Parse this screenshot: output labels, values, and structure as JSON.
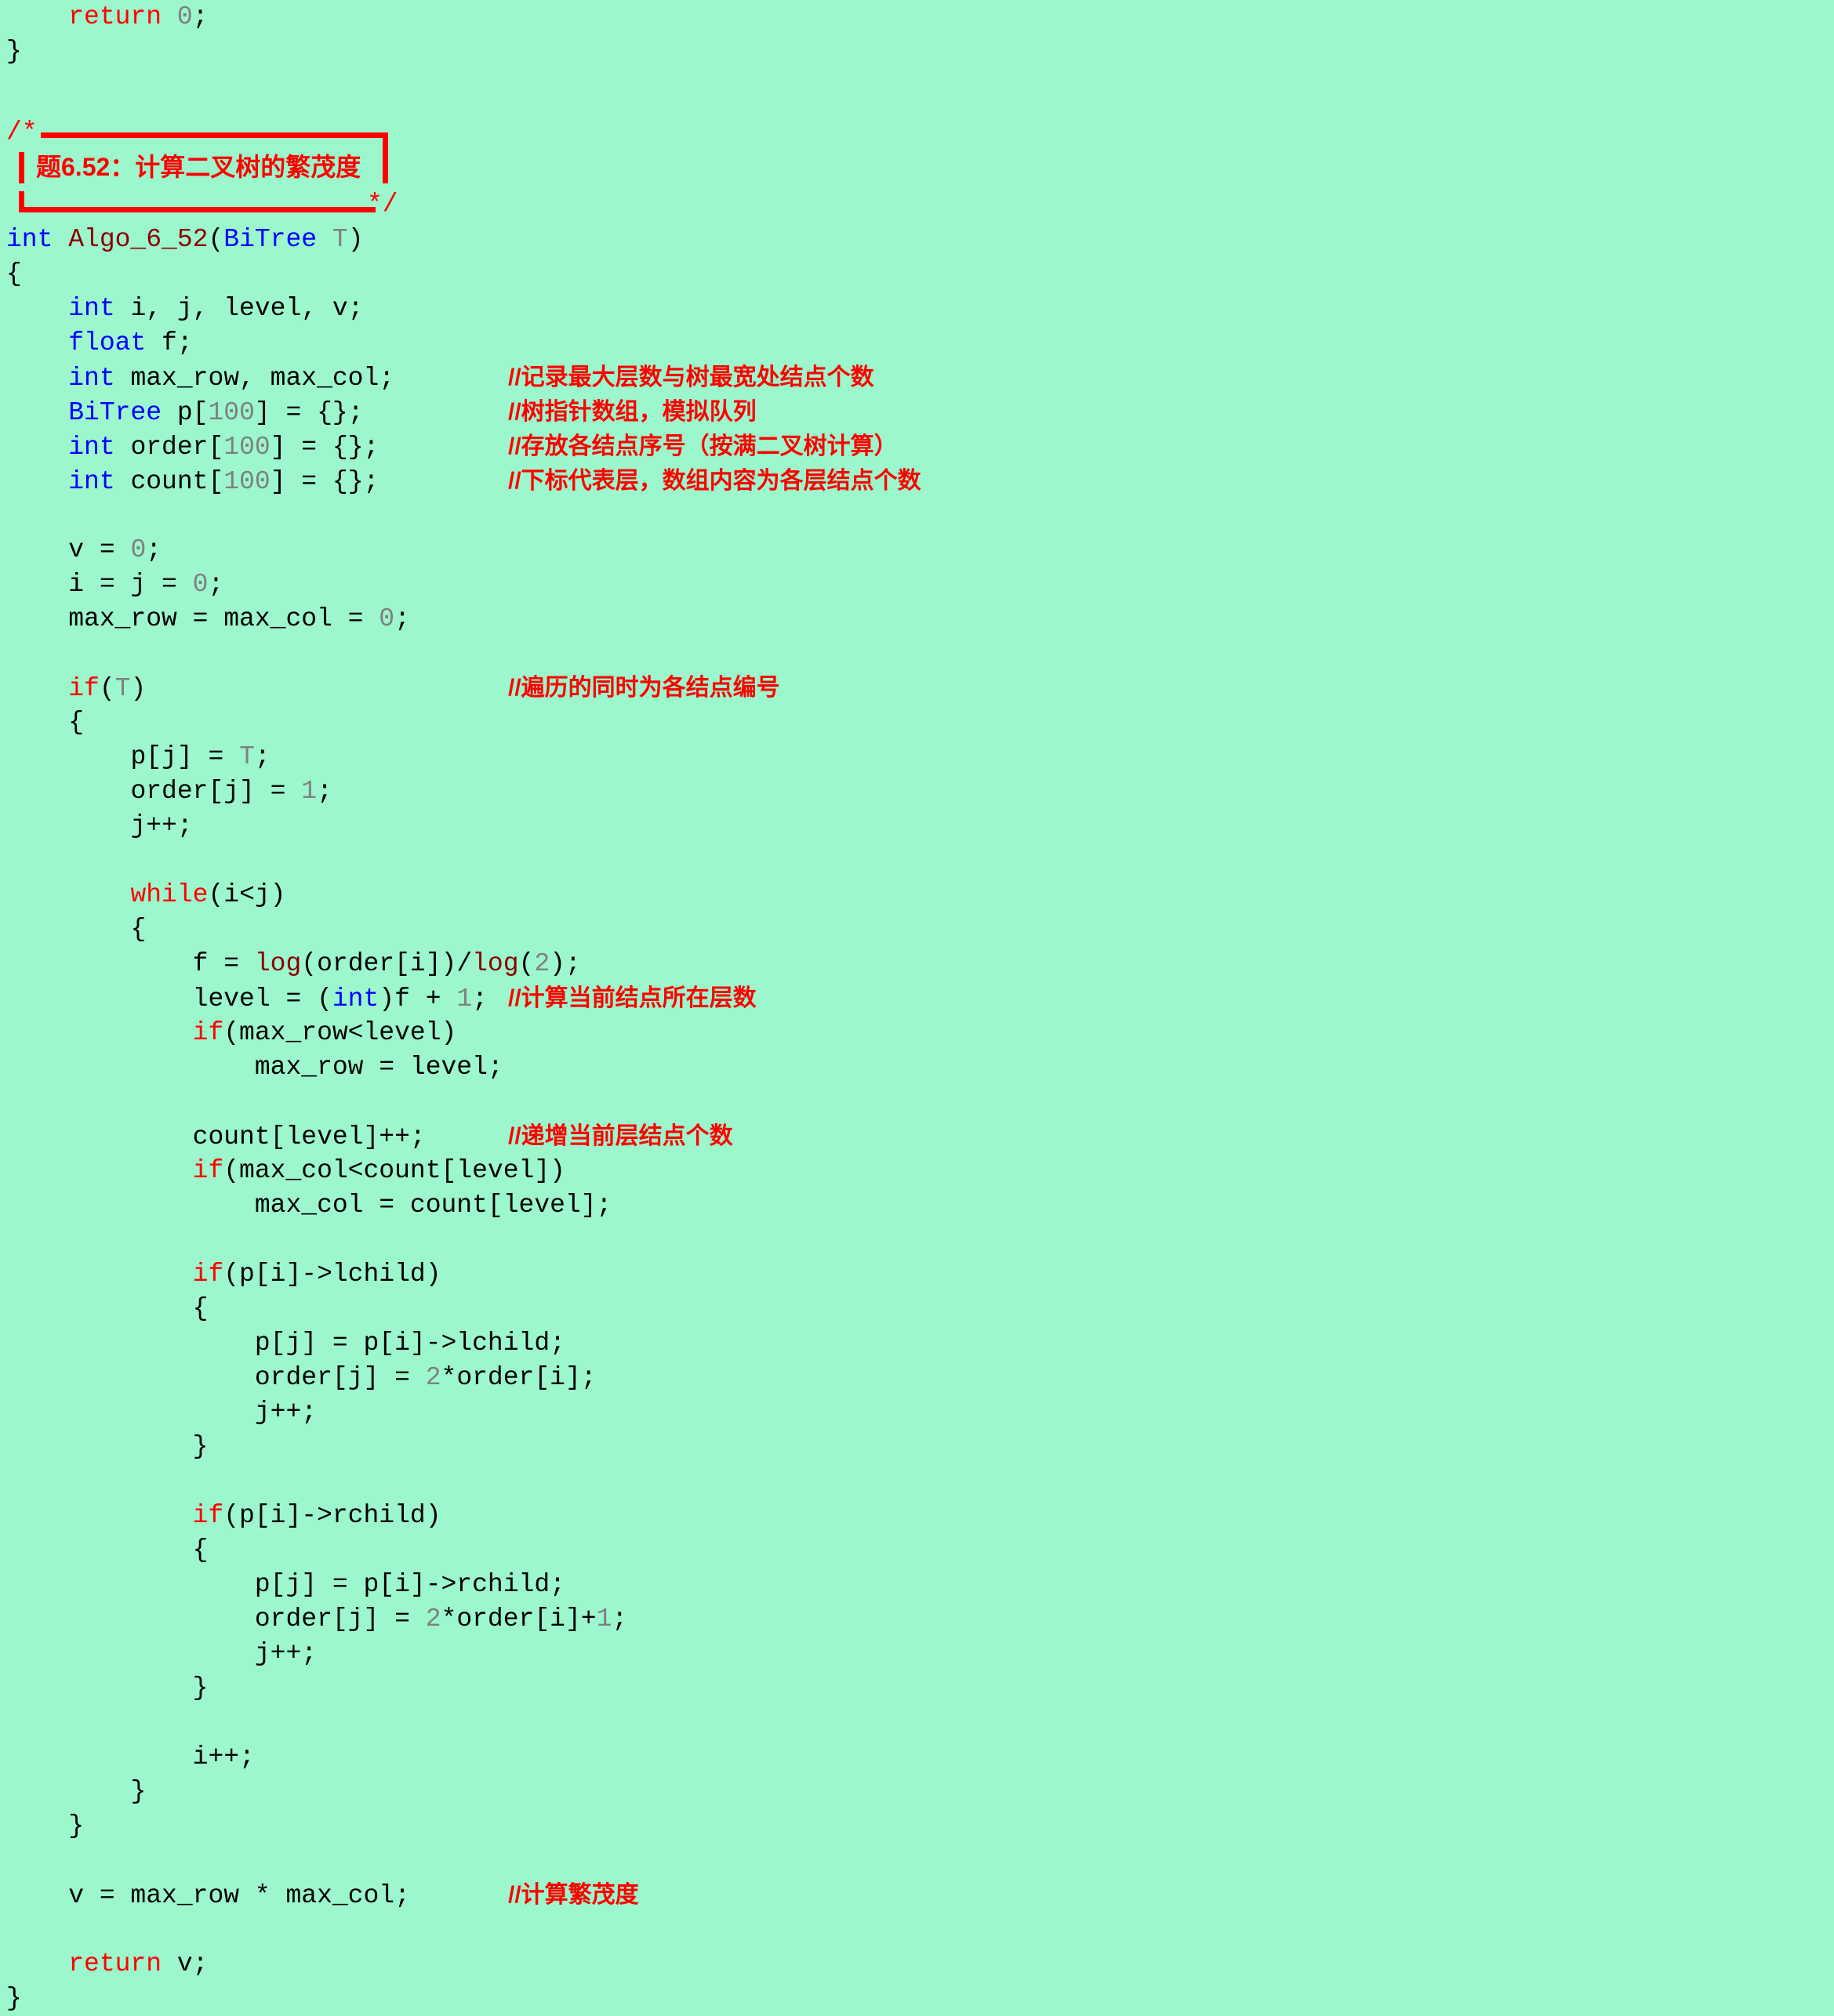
{
  "document": {
    "background_color": "#9cf7cd",
    "language": "C",
    "title_banner": {
      "open_marker": "/*",
      "close_marker": "*/",
      "text": "题6.52：计算二叉树的繁茂度",
      "border_color": "#ff0000",
      "text_color": "#ff0000"
    },
    "colors": {
      "keyword": "#0000ff",
      "control": "#ff0000",
      "function": "#8b0000",
      "number": "#808080",
      "comment": "#ff0000",
      "plain": "#000000"
    }
  },
  "code": {
    "prev_tail": [
      {
        "indent": 1,
        "tokens": [
          {
            "t": "return ",
            "c": "ctrl"
          },
          {
            "t": "0",
            "c": "num"
          },
          {
            "t": ";",
            "c": "plain"
          }
        ]
      },
      {
        "indent": 0,
        "tokens": [
          {
            "t": "}",
            "c": "plain"
          }
        ]
      }
    ],
    "lines": [
      {
        "indent": 0,
        "tokens": [
          {
            "t": "int ",
            "c": "kw"
          },
          {
            "t": "Algo_6_52",
            "c": "fn"
          },
          {
            "t": "(",
            "c": "plain"
          },
          {
            "t": "BiTree",
            "c": "kw"
          },
          {
            "t": " ",
            "c": "plain"
          },
          {
            "t": "T",
            "c": "param"
          },
          {
            "t": ")",
            "c": "plain"
          }
        ]
      },
      {
        "indent": 0,
        "tokens": [
          {
            "t": "{",
            "c": "plain"
          }
        ]
      },
      {
        "indent": 1,
        "tokens": [
          {
            "t": "int ",
            "c": "kw"
          },
          {
            "t": "i, j, level, v;",
            "c": "plain"
          }
        ]
      },
      {
        "indent": 1,
        "tokens": [
          {
            "t": "float ",
            "c": "kw"
          },
          {
            "t": "f;",
            "c": "plain"
          }
        ]
      },
      {
        "indent": 1,
        "tokens": [
          {
            "t": "int ",
            "c": "kw"
          },
          {
            "t": "max_row, max_col;",
            "c": "plain"
          }
        ],
        "comment": "//记录最大层数与树最宽处结点个数"
      },
      {
        "indent": 1,
        "tokens": [
          {
            "t": "BiTree",
            "c": "kw"
          },
          {
            "t": " p[",
            "c": "plain"
          },
          {
            "t": "100",
            "c": "num"
          },
          {
            "t": "] = {};",
            "c": "plain"
          }
        ],
        "comment": "//树指针数组，模拟队列"
      },
      {
        "indent": 1,
        "tokens": [
          {
            "t": "int ",
            "c": "kw"
          },
          {
            "t": "order[",
            "c": "plain"
          },
          {
            "t": "100",
            "c": "num"
          },
          {
            "t": "] = {};",
            "c": "plain"
          }
        ],
        "comment": "//存放各结点序号（按满二叉树计算）"
      },
      {
        "indent": 1,
        "tokens": [
          {
            "t": "int ",
            "c": "kw"
          },
          {
            "t": "count[",
            "c": "plain"
          },
          {
            "t": "100",
            "c": "num"
          },
          {
            "t": "] = {};",
            "c": "plain"
          }
        ],
        "comment": "//下标代表层，数组内容为各层结点个数"
      },
      {
        "blank": true
      },
      {
        "indent": 1,
        "tokens": [
          {
            "t": "v = ",
            "c": "plain"
          },
          {
            "t": "0",
            "c": "num"
          },
          {
            "t": ";",
            "c": "plain"
          }
        ]
      },
      {
        "indent": 1,
        "tokens": [
          {
            "t": "i = j = ",
            "c": "plain"
          },
          {
            "t": "0",
            "c": "num"
          },
          {
            "t": ";",
            "c": "plain"
          }
        ]
      },
      {
        "indent": 1,
        "tokens": [
          {
            "t": "max_row = max_col = ",
            "c": "plain"
          },
          {
            "t": "0",
            "c": "num"
          },
          {
            "t": ";",
            "c": "plain"
          }
        ]
      },
      {
        "blank": true
      },
      {
        "indent": 1,
        "tokens": [
          {
            "t": "if",
            "c": "ctrl"
          },
          {
            "t": "(",
            "c": "plain"
          },
          {
            "t": "T",
            "c": "param"
          },
          {
            "t": ")",
            "c": "plain"
          }
        ],
        "comment": "//遍历的同时为各结点编号"
      },
      {
        "indent": 1,
        "tokens": [
          {
            "t": "{",
            "c": "plain"
          }
        ]
      },
      {
        "indent": 2,
        "tokens": [
          {
            "t": "p[j] = ",
            "c": "plain"
          },
          {
            "t": "T",
            "c": "param"
          },
          {
            "t": ";",
            "c": "plain"
          }
        ]
      },
      {
        "indent": 2,
        "tokens": [
          {
            "t": "order[j] = ",
            "c": "plain"
          },
          {
            "t": "1",
            "c": "num"
          },
          {
            "t": ";",
            "c": "plain"
          }
        ]
      },
      {
        "indent": 2,
        "tokens": [
          {
            "t": "j++;",
            "c": "plain"
          }
        ]
      },
      {
        "blank": true
      },
      {
        "indent": 2,
        "tokens": [
          {
            "t": "while",
            "c": "ctrl"
          },
          {
            "t": "(i<j)",
            "c": "plain"
          }
        ]
      },
      {
        "indent": 2,
        "tokens": [
          {
            "t": "{",
            "c": "plain"
          }
        ]
      },
      {
        "indent": 3,
        "tokens": [
          {
            "t": "f = ",
            "c": "plain"
          },
          {
            "t": "log",
            "c": "fn"
          },
          {
            "t": "(order[i])/",
            "c": "plain"
          },
          {
            "t": "log",
            "c": "fn"
          },
          {
            "t": "(",
            "c": "plain"
          },
          {
            "t": "2",
            "c": "num"
          },
          {
            "t": ");",
            "c": "plain"
          }
        ]
      },
      {
        "indent": 3,
        "tokens": [
          {
            "t": "level = (",
            "c": "plain"
          },
          {
            "t": "int",
            "c": "kw"
          },
          {
            "t": ")f + ",
            "c": "plain"
          },
          {
            "t": "1",
            "c": "num"
          },
          {
            "t": ";",
            "c": "plain"
          }
        ],
        "comment": "//计算当前结点所在层数"
      },
      {
        "indent": 3,
        "tokens": [
          {
            "t": "if",
            "c": "ctrl"
          },
          {
            "t": "(max_row<level)",
            "c": "plain"
          }
        ]
      },
      {
        "indent": 4,
        "tokens": [
          {
            "t": "max_row = level;",
            "c": "plain"
          }
        ]
      },
      {
        "blank": true
      },
      {
        "indent": 3,
        "tokens": [
          {
            "t": "count[level]++;",
            "c": "plain"
          }
        ],
        "comment": "//递增当前层结点个数"
      },
      {
        "indent": 3,
        "tokens": [
          {
            "t": "if",
            "c": "ctrl"
          },
          {
            "t": "(max_col<count[level])",
            "c": "plain"
          }
        ]
      },
      {
        "indent": 4,
        "tokens": [
          {
            "t": "max_col = count[level];",
            "c": "plain"
          }
        ]
      },
      {
        "blank": true
      },
      {
        "indent": 3,
        "tokens": [
          {
            "t": "if",
            "c": "ctrl"
          },
          {
            "t": "(p[i]->lchild)",
            "c": "plain"
          }
        ]
      },
      {
        "indent": 3,
        "tokens": [
          {
            "t": "{",
            "c": "plain"
          }
        ]
      },
      {
        "indent": 4,
        "tokens": [
          {
            "t": "p[j] = p[i]->lchild;",
            "c": "plain"
          }
        ]
      },
      {
        "indent": 4,
        "tokens": [
          {
            "t": "order[j] = ",
            "c": "plain"
          },
          {
            "t": "2",
            "c": "num"
          },
          {
            "t": "*order[i];",
            "c": "plain"
          }
        ]
      },
      {
        "indent": 4,
        "tokens": [
          {
            "t": "j++;",
            "c": "plain"
          }
        ]
      },
      {
        "indent": 3,
        "tokens": [
          {
            "t": "}",
            "c": "plain"
          }
        ]
      },
      {
        "blank": true
      },
      {
        "indent": 3,
        "tokens": [
          {
            "t": "if",
            "c": "ctrl"
          },
          {
            "t": "(p[i]->rchild)",
            "c": "plain"
          }
        ]
      },
      {
        "indent": 3,
        "tokens": [
          {
            "t": "{",
            "c": "plain"
          }
        ]
      },
      {
        "indent": 4,
        "tokens": [
          {
            "t": "p[j] = p[i]->rchild;",
            "c": "plain"
          }
        ]
      },
      {
        "indent": 4,
        "tokens": [
          {
            "t": "order[j] = ",
            "c": "plain"
          },
          {
            "t": "2",
            "c": "num"
          },
          {
            "t": "*order[i]+",
            "c": "plain"
          },
          {
            "t": "1",
            "c": "num"
          },
          {
            "t": ";",
            "c": "plain"
          }
        ]
      },
      {
        "indent": 4,
        "tokens": [
          {
            "t": "j++;",
            "c": "plain"
          }
        ]
      },
      {
        "indent": 3,
        "tokens": [
          {
            "t": "}",
            "c": "plain"
          }
        ]
      },
      {
        "blank": true
      },
      {
        "indent": 3,
        "tokens": [
          {
            "t": "i++;",
            "c": "plain"
          }
        ]
      },
      {
        "indent": 2,
        "tokens": [
          {
            "t": "}",
            "c": "plain"
          }
        ]
      },
      {
        "indent": 1,
        "tokens": [
          {
            "t": "}",
            "c": "plain"
          }
        ]
      },
      {
        "blank": true
      },
      {
        "indent": 1,
        "tokens": [
          {
            "t": "v = max_row * max_col;",
            "c": "plain"
          }
        ],
        "comment": "//计算繁茂度"
      },
      {
        "blank": true
      },
      {
        "indent": 1,
        "tokens": [
          {
            "t": "return ",
            "c": "ctrl"
          },
          {
            "t": "v;",
            "c": "plain"
          }
        ]
      },
      {
        "indent": 0,
        "tokens": [
          {
            "t": "}",
            "c": "plain"
          }
        ]
      }
    ]
  },
  "comments_list": [
    "//记录最大层数与树最宽处结点个数",
    "//树指针数组，模拟队列",
    "//存放各结点序号（按满二叉树计算）",
    "//下标代表层，数组内容为各层结点个数",
    "//遍历的同时为各结点编号",
    "//计算当前结点所在层数",
    "//递增当前层结点个数",
    "//计算繁茂度"
  ]
}
